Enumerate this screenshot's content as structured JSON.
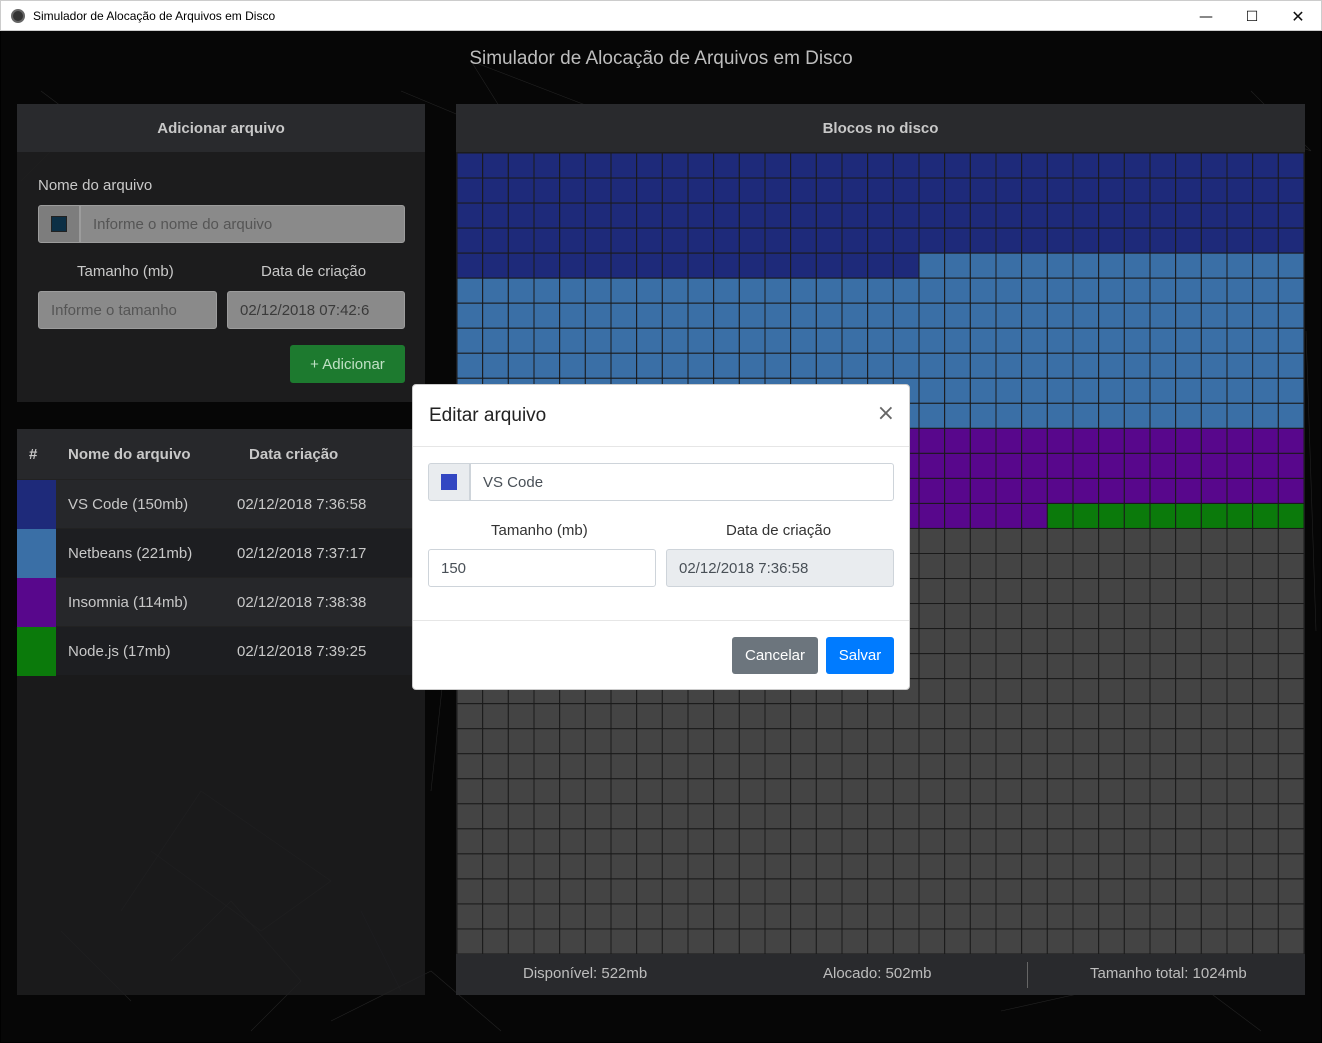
{
  "window": {
    "title": "Simulador de Alocação de Arquivos em Disco",
    "controls": {
      "minimize": "—",
      "maximize": "☐",
      "close": "✕"
    }
  },
  "app": {
    "heading": "Simulador de Alocação de Arquivos em Disco"
  },
  "add_panel": {
    "header": "Adicionar arquivo",
    "name_label": "Nome do arquivo",
    "name_placeholder": "Informe o nome do arquivo",
    "name_swatch_color": "#0c2f45",
    "size_label": "Tamanho (mb)",
    "size_placeholder": "Informe o tamanho",
    "date_label": "Data de criação",
    "date_value": "02/12/2018 07:42:6",
    "add_button": "+ Adicionar"
  },
  "files_table": {
    "columns": [
      "#",
      "Nome do arquivo",
      "Data criação"
    ],
    "rows": [
      {
        "color": "#1e2a7a",
        "name": "VS Code (150mb)",
        "date": "02/12/2018 7:36:58"
      },
      {
        "color": "#3a6fa6",
        "name": "Netbeans (221mb)",
        "date": "02/12/2018 7:37:17"
      },
      {
        "color": "#58078c",
        "name": "Insomnia (114mb)",
        "date": "02/12/2018 7:38:38"
      },
      {
        "color": "#0b7a0b",
        "name": "Node.js (17mb)",
        "date": "02/12/2018 7:39:25"
      }
    ]
  },
  "blocks_panel": {
    "header": "Blocos no disco",
    "grid": {
      "columns": 33,
      "rows": 32,
      "free_color": "#444444",
      "border_color": "#1a1a1a"
    },
    "allocations": [
      {
        "file": "VS Code",
        "blocks": 150,
        "color": "#1e2a7a"
      },
      {
        "file": "Netbeans",
        "blocks": 221,
        "color": "#3a6fa6"
      },
      {
        "file": "Insomnia",
        "blocks": 114,
        "color": "#58078c"
      },
      {
        "file": "Node.js",
        "blocks": 17,
        "color": "#0b7a0b"
      }
    ],
    "stats": {
      "available": "Disponível: 522mb",
      "allocated": "Alocado: 502mb",
      "total": "Tamanho total: 1024mb"
    }
  },
  "edit_modal": {
    "title": "Editar arquivo",
    "close": "×",
    "name_value": "VS Code",
    "swatch_color": "#3347c2",
    "size_label": "Tamanho (mb)",
    "size_value": "150",
    "date_label": "Data de criação",
    "date_value": "02/12/2018 7:36:58",
    "cancel_button": "Cancelar",
    "save_button": "Salvar"
  }
}
